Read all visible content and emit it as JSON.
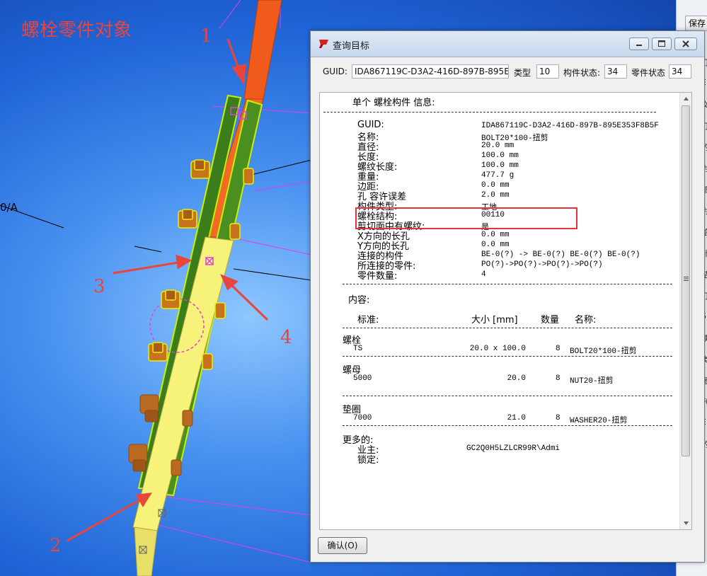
{
  "annotation": {
    "title": "螺栓零件对象",
    "markers": [
      "1",
      "2",
      "3",
      "4"
    ]
  },
  "scene": {
    "axis_label": "0/A",
    "colors": {
      "background": "#1f63d6",
      "member_orange": "#f05a1a",
      "plate_green": "#3a7d1a",
      "plate_yellow": "#f7f27a",
      "bolt_brown": "#c8741f",
      "grid_magenta": "#e040e0",
      "annotation_red": "#e8453c"
    }
  },
  "background_app": {
    "save_label": "保存",
    "strip_chars": [
      "打",
      "E",
      "文",
      "打",
      "的",
      "为",
      "参",
      "为",
      "绘",
      "补",
      "结",
      "打",
      "S",
      "读",
      "类",
      "图",
      "列",
      "E",
      "的"
    ]
  },
  "dialog": {
    "title": "查询目标",
    "guid_label": "GUID:",
    "guid_value": "IDA867119C-D3A2-416D-897B-895E353F8B5F",
    "type_label": "类型",
    "type_value": "10",
    "member_status_label": "构件状态:",
    "member_status_value": "34",
    "part_status_label": "零件状态",
    "part_status_value": "34",
    "ok_label": "确认(O)",
    "report": {
      "heading": "单个 螺栓构件 信息:",
      "rows": [
        {
          "label": "GUID:",
          "value": "IDA867119C-D3A2-416D-897B-895E353F8B5F"
        },
        {
          "label": "名称:",
          "value": "BOLT20*100-扭剪"
        },
        {
          "label": "直径:",
          "value": "20.0 mm"
        },
        {
          "label": "长度:",
          "value": "100.0 mm"
        },
        {
          "label": "螺纹长度:",
          "value": "100.0 mm"
        },
        {
          "label": "重量:",
          "value": "477.7 g"
        },
        {
          "label": "边距:",
          "value": "0.0 mm"
        },
        {
          "label": "孔 容许误差",
          "value": "2.0 mm"
        },
        {
          "label": "构件类型:",
          "value": "工地"
        },
        {
          "label": "螺栓结构:",
          "value": "00110"
        },
        {
          "label": "剪切面中有螺纹:",
          "value": "是"
        },
        {
          "label": "X方向的长孔",
          "value": "0.0 mm"
        },
        {
          "label": "Y方向的长孔",
          "value": "0.0 mm"
        },
        {
          "label": "连接的构件",
          "value": "BE-0(?) -> BE-0(?) BE-0(?) BE-0(?)"
        },
        {
          "label": "所连接的零件:",
          "value": "PO(?)->PO(?)->PO(?)->PO(?)"
        },
        {
          "label": "零件数量:",
          "value": "4"
        }
      ],
      "content_label": "内容:",
      "columns": [
        "标准:",
        "大小 [mm]",
        "数量",
        "名称:"
      ],
      "groups": [
        {
          "name": "螺栓",
          "standard": "TS",
          "size": "20.0 x 100.0",
          "qty": "8",
          "part_name": "BOLT20*100-扭剪"
        },
        {
          "name": "螺母",
          "standard": "5000",
          "size": "20.0",
          "qty": "8",
          "part_name": "NUT20-扭剪"
        },
        {
          "name": "垫圈",
          "standard": "7000",
          "size": "21.0",
          "qty": "8",
          "part_name": "WASHER20-扭剪"
        }
      ],
      "more_label": "更多的:",
      "owner_label": "业主:",
      "owner_value": "GC2Q0H5LZLCR99R\\Admi",
      "lock_label": "锁定:"
    }
  }
}
